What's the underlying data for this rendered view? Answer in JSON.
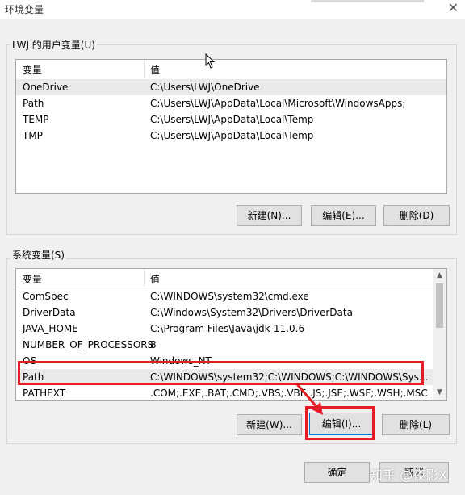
{
  "window": {
    "title": "环境变量"
  },
  "user_vars": {
    "group_label": "LWJ 的用户变量(U)",
    "columns": [
      "变量",
      "值"
    ],
    "rows": [
      {
        "name": "OneDrive",
        "value": "C:\\Users\\LWJ\\OneDrive"
      },
      {
        "name": "Path",
        "value": "C:\\Users\\LWJ\\AppData\\Local\\Microsoft\\WindowsApps;"
      },
      {
        "name": "TEMP",
        "value": "C:\\Users\\LWJ\\AppData\\Local\\Temp"
      },
      {
        "name": "TMP",
        "value": "C:\\Users\\LWJ\\AppData\\Local\\Temp"
      }
    ],
    "buttons": {
      "new": "新建(N)...",
      "edit": "编辑(E)...",
      "delete": "删除(D)"
    }
  },
  "system_vars": {
    "group_label": "系统变量(S)",
    "columns": [
      "变量",
      "值"
    ],
    "rows": [
      {
        "name": "ComSpec",
        "value": "C:\\WINDOWS\\system32\\cmd.exe"
      },
      {
        "name": "DriverData",
        "value": "C:\\Windows\\System32\\Drivers\\DriverData"
      },
      {
        "name": "JAVA_HOME",
        "value": "C:\\Program Files\\Java\\jdk-11.0.6"
      },
      {
        "name": "NUMBER_OF_PROCESSORS",
        "value": "8"
      },
      {
        "name": "OS",
        "value": "Windows_NT"
      },
      {
        "name": "Path",
        "value": "C:\\WINDOWS\\system32;C:\\WINDOWS;C:\\WINDOWS\\System..."
      },
      {
        "name": "PATHEXT",
        "value": ".COM;.EXE;.BAT;.CMD;.VBS;.VBE;.JS;.JSE;.WSF;.WSH;.MSC"
      }
    ],
    "buttons": {
      "new": "新建(W)...",
      "edit": "编辑(I)...",
      "delete": "删除(L)"
    }
  },
  "dialog_buttons": {
    "ok": "确定",
    "cancel": "取消"
  },
  "watermark": "知乎 @夜影X",
  "colors": {
    "highlight": "#e51c23",
    "selected_row": "#eaeaea"
  }
}
